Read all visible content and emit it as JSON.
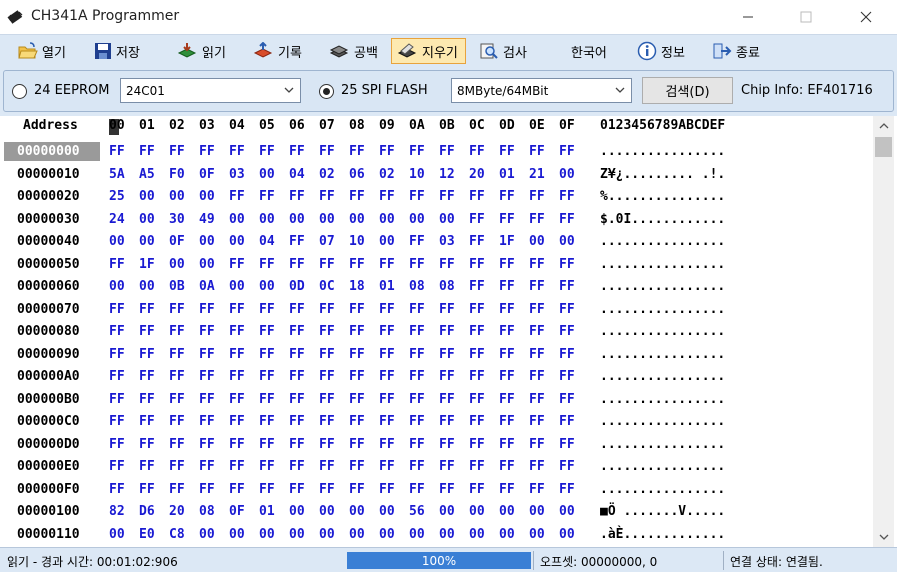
{
  "window": {
    "title": "CH341A Programmer"
  },
  "toolbar": {
    "open": "열기",
    "save": "저장",
    "read": "읽기",
    "write": "기록",
    "blank": "공백",
    "erase": "지우기",
    "verify": "검사",
    "language": "한국어",
    "info": "정보",
    "exit": "종료"
  },
  "chip": {
    "eeprom_label": "24 EEPROM",
    "eeprom_value": "24C01",
    "spi_label": "25 SPI FLASH",
    "spi_value": "8MByte/64MBit",
    "detect_label": "검색(D)",
    "chip_info": "Chip Info: EF401716"
  },
  "hex": {
    "address_header": "Address",
    "columns": [
      "00",
      "01",
      "02",
      "03",
      "04",
      "05",
      "06",
      "07",
      "08",
      "09",
      "0A",
      "0B",
      "0C",
      "0D",
      "0E",
      "0F"
    ],
    "ascii_header": "0123456789ABCDEF",
    "rows": [
      {
        "addr": "00000000",
        "bytes": [
          "FF",
          "FF",
          "FF",
          "FF",
          "FF",
          "FF",
          "FF",
          "FF",
          "FF",
          "FF",
          "FF",
          "FF",
          "FF",
          "FF",
          "FF",
          "FF"
        ],
        "ascii": "................"
      },
      {
        "addr": "00000010",
        "bytes": [
          "5A",
          "A5",
          "F0",
          "0F",
          "03",
          "00",
          "04",
          "02",
          "06",
          "02",
          "10",
          "12",
          "20",
          "01",
          "21",
          "00"
        ],
        "ascii": "Z¥¿......... .!."
      },
      {
        "addr": "00000020",
        "bytes": [
          "25",
          "00",
          "00",
          "00",
          "FF",
          "FF",
          "FF",
          "FF",
          "FF",
          "FF",
          "FF",
          "FF",
          "FF",
          "FF",
          "FF",
          "FF"
        ],
        "ascii": "%..............."
      },
      {
        "addr": "00000030",
        "bytes": [
          "24",
          "00",
          "30",
          "49",
          "00",
          "00",
          "00",
          "00",
          "00",
          "00",
          "00",
          "00",
          "FF",
          "FF",
          "FF",
          "FF"
        ],
        "ascii": "$.0I............"
      },
      {
        "addr": "00000040",
        "bytes": [
          "00",
          "00",
          "0F",
          "00",
          "00",
          "04",
          "FF",
          "07",
          "10",
          "00",
          "FF",
          "03",
          "FF",
          "1F",
          "00",
          "00"
        ],
        "ascii": "................"
      },
      {
        "addr": "00000050",
        "bytes": [
          "FF",
          "1F",
          "00",
          "00",
          "FF",
          "FF",
          "FF",
          "FF",
          "FF",
          "FF",
          "FF",
          "FF",
          "FF",
          "FF",
          "FF",
          "FF"
        ],
        "ascii": "................"
      },
      {
        "addr": "00000060",
        "bytes": [
          "00",
          "00",
          "0B",
          "0A",
          "00",
          "00",
          "0D",
          "0C",
          "18",
          "01",
          "08",
          "08",
          "FF",
          "FF",
          "FF",
          "FF"
        ],
        "ascii": "................"
      },
      {
        "addr": "00000070",
        "bytes": [
          "FF",
          "FF",
          "FF",
          "FF",
          "FF",
          "FF",
          "FF",
          "FF",
          "FF",
          "FF",
          "FF",
          "FF",
          "FF",
          "FF",
          "FF",
          "FF"
        ],
        "ascii": "................"
      },
      {
        "addr": "00000080",
        "bytes": [
          "FF",
          "FF",
          "FF",
          "FF",
          "FF",
          "FF",
          "FF",
          "FF",
          "FF",
          "FF",
          "FF",
          "FF",
          "FF",
          "FF",
          "FF",
          "FF"
        ],
        "ascii": "................"
      },
      {
        "addr": "00000090",
        "bytes": [
          "FF",
          "FF",
          "FF",
          "FF",
          "FF",
          "FF",
          "FF",
          "FF",
          "FF",
          "FF",
          "FF",
          "FF",
          "FF",
          "FF",
          "FF",
          "FF"
        ],
        "ascii": "................"
      },
      {
        "addr": "000000A0",
        "bytes": [
          "FF",
          "FF",
          "FF",
          "FF",
          "FF",
          "FF",
          "FF",
          "FF",
          "FF",
          "FF",
          "FF",
          "FF",
          "FF",
          "FF",
          "FF",
          "FF"
        ],
        "ascii": "................"
      },
      {
        "addr": "000000B0",
        "bytes": [
          "FF",
          "FF",
          "FF",
          "FF",
          "FF",
          "FF",
          "FF",
          "FF",
          "FF",
          "FF",
          "FF",
          "FF",
          "FF",
          "FF",
          "FF",
          "FF"
        ],
        "ascii": "................"
      },
      {
        "addr": "000000C0",
        "bytes": [
          "FF",
          "FF",
          "FF",
          "FF",
          "FF",
          "FF",
          "FF",
          "FF",
          "FF",
          "FF",
          "FF",
          "FF",
          "FF",
          "FF",
          "FF",
          "FF"
        ],
        "ascii": "................"
      },
      {
        "addr": "000000D0",
        "bytes": [
          "FF",
          "FF",
          "FF",
          "FF",
          "FF",
          "FF",
          "FF",
          "FF",
          "FF",
          "FF",
          "FF",
          "FF",
          "FF",
          "FF",
          "FF",
          "FF"
        ],
        "ascii": "................"
      },
      {
        "addr": "000000E0",
        "bytes": [
          "FF",
          "FF",
          "FF",
          "FF",
          "FF",
          "FF",
          "FF",
          "FF",
          "FF",
          "FF",
          "FF",
          "FF",
          "FF",
          "FF",
          "FF",
          "FF"
        ],
        "ascii": "................"
      },
      {
        "addr": "000000F0",
        "bytes": [
          "FF",
          "FF",
          "FF",
          "FF",
          "FF",
          "FF",
          "FF",
          "FF",
          "FF",
          "FF",
          "FF",
          "FF",
          "FF",
          "FF",
          "FF",
          "FF"
        ],
        "ascii": "................"
      },
      {
        "addr": "00000100",
        "bytes": [
          "82",
          "D6",
          "20",
          "08",
          "0F",
          "01",
          "00",
          "00",
          "00",
          "00",
          "56",
          "00",
          "00",
          "00",
          "00",
          "00"
        ],
        "ascii": "■Ö .......V....."
      },
      {
        "addr": "00000110",
        "bytes": [
          "00",
          "E0",
          "C8",
          "00",
          "00",
          "00",
          "00",
          "00",
          "00",
          "00",
          "00",
          "00",
          "00",
          "00",
          "00",
          "00"
        ],
        "ascii": ".àÈ............."
      }
    ]
  },
  "status": {
    "elapsed": "읽기 - 경과 시간: 00:01:02:906",
    "progress_label": "100%",
    "progress": 1.0,
    "offset": "오프셋: 00000000, 0",
    "connection": "연결 상태: 연결됨."
  },
  "colors": {
    "byte_text": "#1a1ad2",
    "toolbar_bg": "#dce8f5",
    "progress": "#3a7fd5",
    "selected_addr": "#9a9a9a"
  }
}
